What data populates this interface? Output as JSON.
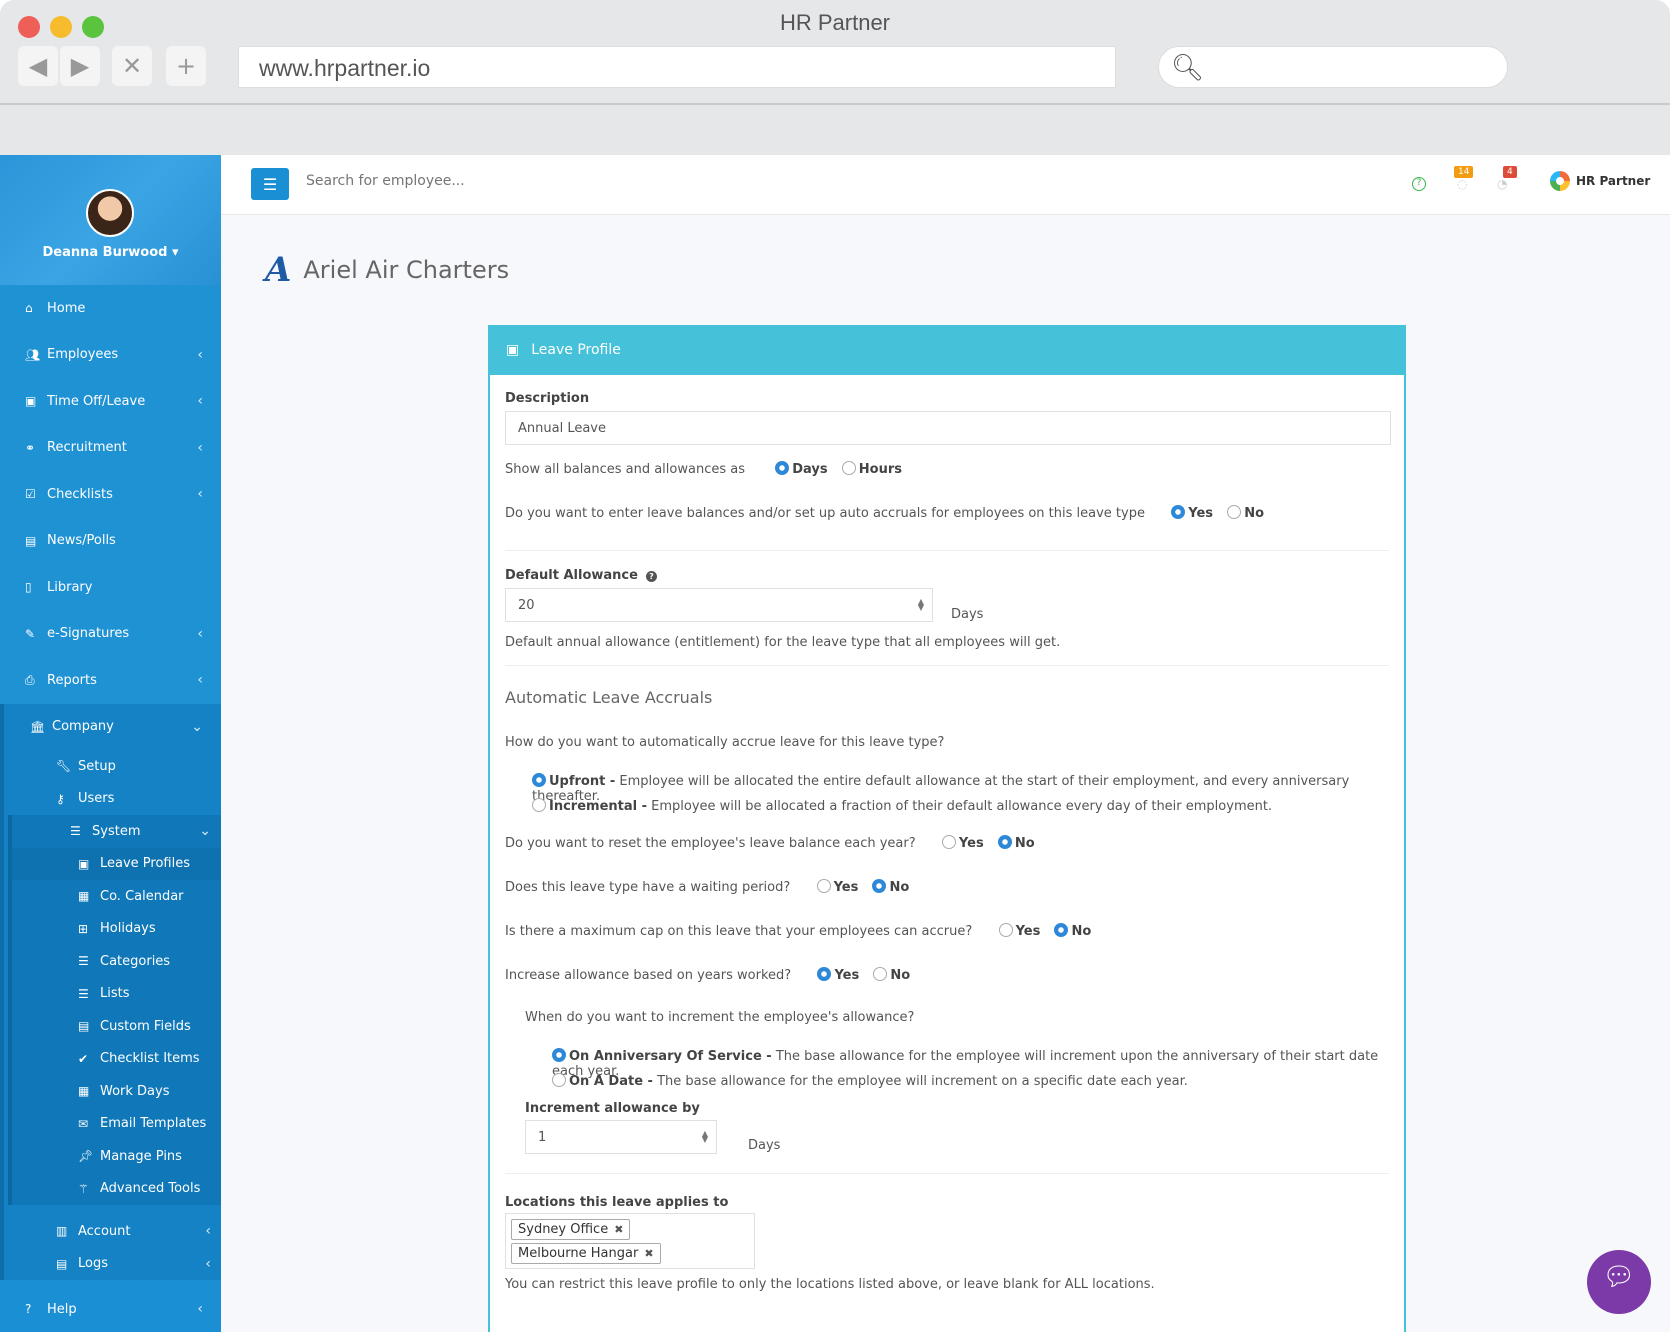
{
  "window": {
    "title": "HR Partner",
    "url": "www.hrpartner.io"
  },
  "user": {
    "name": "Deanna Burwood"
  },
  "sidebar": {
    "items": [
      {
        "label": "Home",
        "icon": "home-icon",
        "chev": ""
      },
      {
        "label": "Employees",
        "icon": "users-icon",
        "chev": "‹"
      },
      {
        "label": "Time Off/Leave",
        "icon": "briefcase-icon",
        "chev": "‹"
      },
      {
        "label": "Recruitment",
        "icon": "handshake-icon",
        "chev": "‹"
      },
      {
        "label": "Checklists",
        "icon": "check-square-icon",
        "chev": "‹"
      },
      {
        "label": "News/Polls",
        "icon": "newspaper-icon",
        "chev": ""
      },
      {
        "label": "Library",
        "icon": "file-icon",
        "chev": ""
      },
      {
        "label": "e-Signatures",
        "icon": "pencil-icon",
        "chev": "‹"
      },
      {
        "label": "Reports",
        "icon": "print-icon",
        "chev": "‹"
      }
    ],
    "company": {
      "label": "Company",
      "children": [
        {
          "label": "Setup",
          "icon": "wrench-icon"
        },
        {
          "label": "Users",
          "icon": "key-icon"
        }
      ],
      "system": {
        "label": "System",
        "children": [
          {
            "label": "Leave Profiles",
            "icon": "briefcase-icon"
          },
          {
            "label": "Co. Calendar",
            "icon": "calendar-icon"
          },
          {
            "label": "Holidays",
            "icon": "calendar-plus-icon"
          },
          {
            "label": "Categories",
            "icon": "list-icon"
          },
          {
            "label": "Lists",
            "icon": "list-icon"
          },
          {
            "label": "Custom Fields",
            "icon": "table-icon"
          },
          {
            "label": "Checklist Items",
            "icon": "check-icon"
          },
          {
            "label": "Work Days",
            "icon": "calendar-icon"
          },
          {
            "label": "Email Templates",
            "icon": "envelope-icon"
          },
          {
            "label": "Manage Pins",
            "icon": "pin-icon"
          },
          {
            "label": "Advanced Tools",
            "icon": "magic-wand-icon"
          }
        ]
      },
      "account": "Account",
      "logs": "Logs"
    },
    "help": "Help"
  },
  "topbar": {
    "search_placeholder": "Search for employee...",
    "badge_orange": "14",
    "badge_red": "4",
    "brand": "HR Partner"
  },
  "company": {
    "logo_letter": "A",
    "name": "Ariel Air Charters"
  },
  "panel": {
    "title": "Leave Profile",
    "description_label": "Description",
    "description_value": "Annual Leave",
    "show_balances_q": "Show all balances and allowances as",
    "show_balances_opts": [
      "Days",
      "Hours"
    ],
    "enter_balances_q": "Do you want to enter leave balances and/or set up auto accruals for employees on this leave type",
    "yes": "Yes",
    "no": "No",
    "default_allowance_label": "Default Allowance",
    "default_allowance_value": "20",
    "days": "Days",
    "default_allowance_help": "Default annual allowance (entitlement) for the leave type that all employees will get.",
    "accruals_title": "Automatic Leave Accruals",
    "accrue_q": "How do you want to automatically accrue leave for this leave type?",
    "upfront_label": "Upfront -",
    "upfront_desc": "Employee will be allocated the entire default allowance at the start of their employment, and every anniversary thereafter.",
    "incremental_label": "Incremental -",
    "incremental_desc": "Employee will be allocated a fraction of their default allowance every day of their employment.",
    "reset_q": "Do you want to reset the employee's leave balance each year?",
    "waiting_q": "Does this leave type have a waiting period?",
    "cap_q": "Is there a maximum cap on this leave that your employees can accrue?",
    "increase_q": "Increase allowance based on years worked?",
    "when_q": "When do you want to increment the employee's allowance?",
    "anniv_label": "On Anniversary Of Service -",
    "anniv_desc": "The base allowance for the employee will increment upon the anniversary of their start date each year.",
    "date_label": "On A Date -",
    "date_desc": "The base allowance for the employee will increment on a specific date each year.",
    "increment_label": "Increment allowance by",
    "increment_value": "1",
    "locations_label": "Locations this leave applies to",
    "locations": [
      "Sydney Office",
      "Melbourne Hangar"
    ],
    "locations_help": "You can restrict this leave profile to only the locations listed above, or leave blank for ALL locations."
  },
  "colors": {
    "sidebar": "#1a8fd3",
    "panel_header": "#45c1da",
    "radio_selected": "#2d88d8",
    "chat": "#7c3aa8"
  }
}
